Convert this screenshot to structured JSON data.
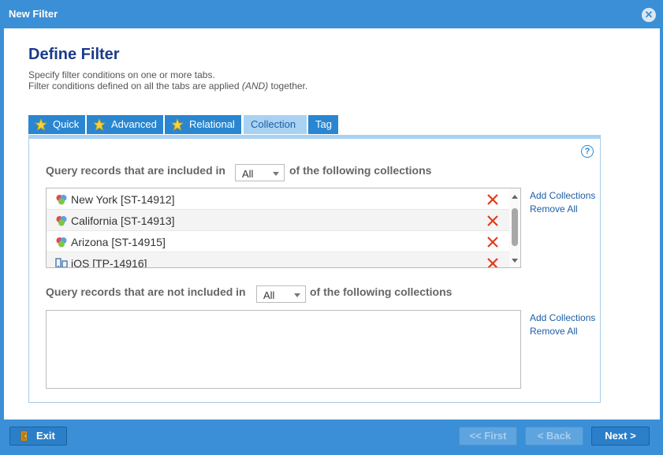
{
  "window": {
    "title": "New Filter",
    "close_icon": "close-icon"
  },
  "header": {
    "title": "Define Filter",
    "line1": "Specify filter conditions on one or more tabs.",
    "line2_pre": "Filter conditions defined on all the tabs are applied ",
    "line2_em": "(AND)",
    "line2_post": " together."
  },
  "tabs": [
    {
      "label": "Quick",
      "icon": "star-icon"
    },
    {
      "label": "Advanced",
      "icon": "star-icon"
    },
    {
      "label": "Relational",
      "icon": "star-icon"
    },
    {
      "label": "Collection",
      "active": true
    },
    {
      "label": "Tag"
    }
  ],
  "panel": {
    "help": "?",
    "included": {
      "prefix": "Query records that are included in",
      "select_value": "All",
      "suffix": "of the following collections",
      "items": [
        {
          "name": "New York [ST-14912]",
          "icon": "collection-icon"
        },
        {
          "name": "California [ST-14913]",
          "icon": "collection-icon"
        },
        {
          "name": "Arizona [ST-14915]",
          "icon": "collection-icon"
        },
        {
          "name": "iOS [TP-14916]",
          "icon": "device-icon"
        }
      ],
      "add_link": "Add Collections",
      "remove_link": "Remove All"
    },
    "excluded": {
      "prefix": "Query records that are not included in",
      "select_value": "All",
      "suffix": "of the following collections",
      "items": [],
      "add_link": "Add Collections",
      "remove_link": "Remove All"
    }
  },
  "footer": {
    "exit": "Exit",
    "first": "<< First",
    "back": "< Back",
    "next": "Next >"
  },
  "colors": {
    "accent": "#3b8fd6",
    "tab": "#2a86d0",
    "tab_active": "#a9d2f2",
    "delete": "#e03c1e",
    "title": "#1b3a8a"
  }
}
